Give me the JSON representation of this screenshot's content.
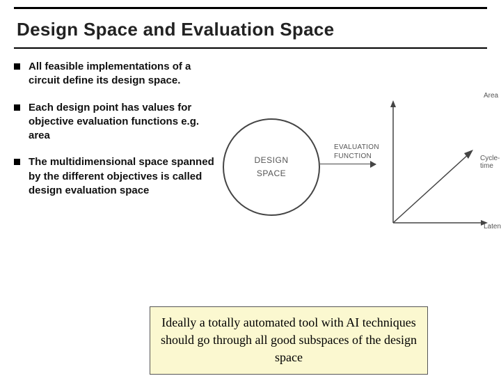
{
  "title": "Design Space and Evaluation Space",
  "bullets": [
    "All feasible implementations of a circuit define its design space.",
    "Each design point has values for objective evaluation functions e.g. area",
    "The multidimensional space spanned by the different objectives is called design evaluation space"
  ],
  "diagram": {
    "circle_line1": "DESIGN",
    "circle_line2": "SPACE",
    "ef_line1": "EVALUATION",
    "ef_line2": "FUNCTION",
    "axis_y": "Area",
    "axis_x": "Latency",
    "axis_diag": "Cycle-time"
  },
  "callout": "Ideally a totally automated tool with AI techniques should go through all good subspaces of the design space"
}
